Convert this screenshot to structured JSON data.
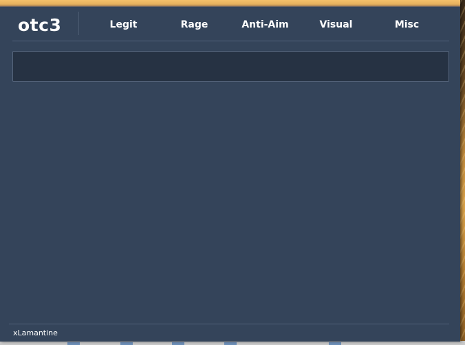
{
  "menu": {
    "logo": "otc3",
    "tabs": [
      {
        "label": "Legit"
      },
      {
        "label": "Rage"
      },
      {
        "label": "Anti-Aim"
      },
      {
        "label": "Visual"
      },
      {
        "label": "Misc"
      }
    ],
    "footer_user": "xLamantine"
  },
  "colors": {
    "accent": "#f4c06a",
    "panel": "#34445a",
    "content_box": "#263243",
    "text": "#ffffff"
  }
}
